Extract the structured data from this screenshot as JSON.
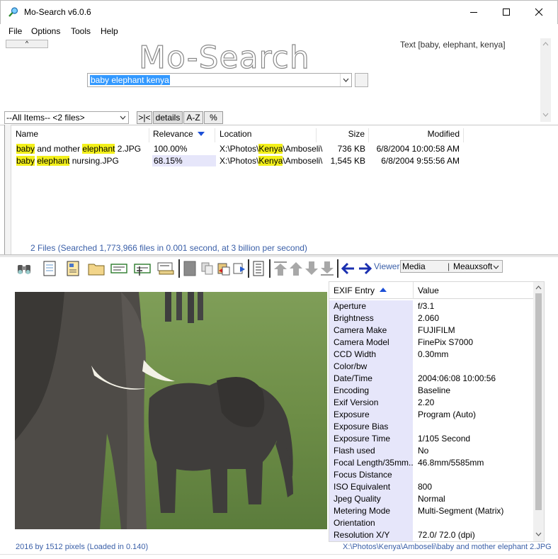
{
  "window": {
    "title": "Mo-Search v6.0.6"
  },
  "menu": [
    "File",
    "Options",
    "Tools",
    "Help"
  ],
  "search": {
    "logo": "Mo-Search",
    "query": "baby elephant kenya",
    "query_display": "Text [baby, elephant, kenya]",
    "collapse_label": "^"
  },
  "filter": {
    "selected": "--All Items-- <2 files>",
    "buttons": [
      ">|<",
      "details",
      "A-Z",
      "%"
    ]
  },
  "file_list": {
    "columns": [
      "Name",
      "Relevance",
      "Location",
      "Size",
      "Modified"
    ],
    "rows": [
      {
        "name_parts": [
          [
            "baby",
            true
          ],
          [
            " and mother ",
            false
          ],
          [
            "elephant",
            true
          ],
          [
            " 2.JPG",
            false
          ]
        ],
        "relevance": "100.00%",
        "location_parts": [
          [
            "X:\\Photos\\",
            false
          ],
          [
            "Kenya",
            true
          ],
          [
            "\\Amboseli\\",
            false
          ]
        ],
        "size": "736 KB",
        "modified": "6/8/2004 10:00:58 AM"
      },
      {
        "name_parts": [
          [
            "baby",
            true
          ],
          [
            " ",
            false
          ],
          [
            "elephant",
            true
          ],
          [
            " nursing.JPG",
            false
          ]
        ],
        "relevance": "68.15%",
        "location_parts": [
          [
            "X:\\Photos\\",
            false
          ],
          [
            "Kenya",
            true
          ],
          [
            "\\Amboseli\\",
            false
          ]
        ],
        "size": "1,545 KB",
        "modified": "6/8/2004 9:55:56 AM"
      }
    ],
    "status": "2 Files  (Searched 1,773,966 files in 0.001 second, at 3 billion per second)"
  },
  "viewer": {
    "label": "Viewer",
    "option_1": "Media",
    "option_2": "Meauxsoft"
  },
  "exif": {
    "header_key": "EXIF Entry",
    "header_value": "Value",
    "rows": [
      [
        "Aperture",
        "f/3.1"
      ],
      [
        "Brightness",
        "2.060"
      ],
      [
        "Camera Make",
        "FUJIFILM"
      ],
      [
        "Camera Model",
        "FinePix S7000"
      ],
      [
        "CCD Width",
        "0.30mm"
      ],
      [
        "Color/bw",
        ""
      ],
      [
        "Date/Time",
        "2004:06:08 10:00:56"
      ],
      [
        "Encoding",
        "Baseline"
      ],
      [
        "Exif Version",
        "2.20"
      ],
      [
        "Exposure",
        "Program (Auto)"
      ],
      [
        "Exposure Bias",
        ""
      ],
      [
        "Exposure Time",
        "1/105 Second"
      ],
      [
        "Flash used",
        "No"
      ],
      [
        "Focal Length/35mm...",
        "46.8mm/5585mm"
      ],
      [
        "Focus Distance",
        ""
      ],
      [
        "ISO Equivalent",
        "800"
      ],
      [
        "Jpeg Quality",
        "Normal"
      ],
      [
        "Metering Mode",
        "Multi-Segment (Matrix)"
      ],
      [
        "Orientation",
        ""
      ],
      [
        "Resolution X/Y",
        "72.0/ 72.0 (dpi)"
      ]
    ]
  },
  "status_bar": {
    "image_info": "2016 by 1512 pixels (Loaded in 0.140)",
    "path": "X:\\Photos\\Kenya\\Amboseli\\baby and mother elephant 2.JPG"
  },
  "icons": [
    "magnifier-app-icon",
    "binoculars-icon",
    "notepad-icon",
    "document-icon",
    "folder-icon",
    "card-icon",
    "insert-card-icon",
    "scanner-icon",
    "grey-block-icon",
    "copy-icon",
    "paste-icon",
    "export-icon",
    "page-icon",
    "arrow-up-top-icon",
    "arrow-up-icon",
    "arrow-down-icon",
    "arrow-down-bottom-icon",
    "back-arrow-icon",
    "forward-arrow-icon"
  ],
  "colors": {
    "highlight": "#f3f01a",
    "status_text": "#3a5fa8",
    "selection": "#3399ff",
    "relevance_bg": "#e6e6fa"
  }
}
